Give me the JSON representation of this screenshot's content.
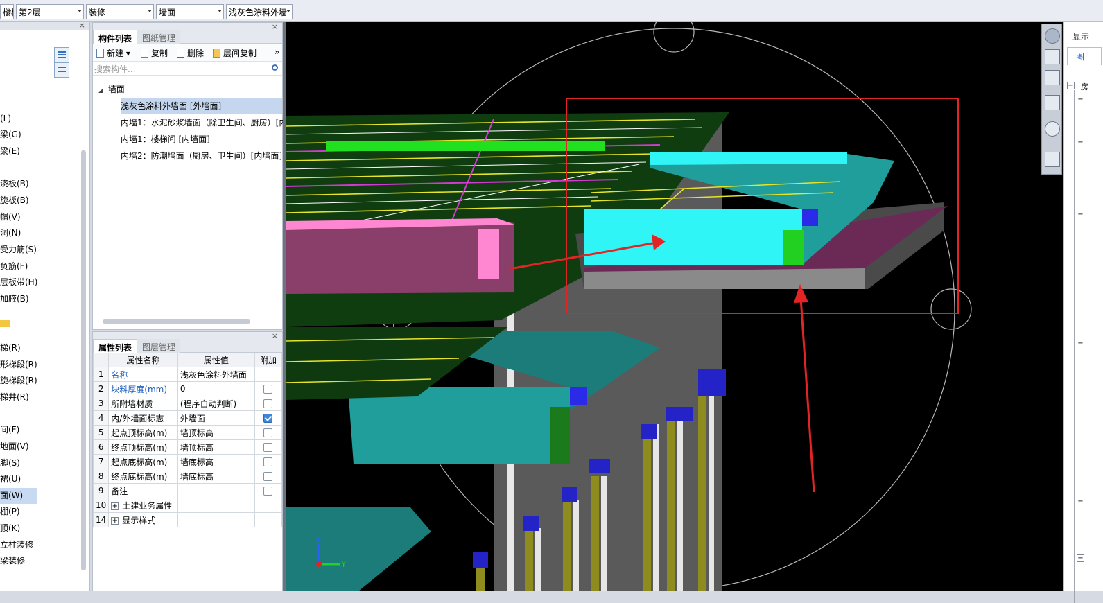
{
  "toolbar": {
    "combo0": "楼梯",
    "combo1": "第2层",
    "combo2": "装修",
    "combo3": "墙面",
    "combo4": "浅灰色涂料外墙"
  },
  "left_nav": [
    "(L)",
    "梁(G)",
    "梁(E)",
    "浇板(B)",
    "旋板(B)",
    "帽(V)",
    "洞(N)",
    "受力筋(S)",
    "负筋(F)",
    "层板带(H)",
    "加腋(B)",
    "梯(R)",
    "形梯段(R)",
    "旋梯段(R)",
    "梯井(R)",
    "间(F)",
    "地面(V)",
    "脚(S)",
    "裙(U)",
    "面(W)",
    "棚(P)",
    "顶(K)",
    "立柱装修",
    "梁装修"
  ],
  "comp_panel": {
    "tab_active": "构件列表",
    "tab_inactive": "图纸管理",
    "btn_new": "新建",
    "btn_copy": "复制",
    "btn_delete": "删除",
    "btn_floor_copy": "层间复制",
    "search_placeholder": "搜索构件...",
    "tree_root": "墙面",
    "items": [
      "浅灰色涂料外墙面 [外墙面]",
      "内墙1：水泥砂浆墙面（除卫生间、厨房）[内",
      "内墙1：楼梯间 [内墙面]",
      "内墙2：防潮墙面（厨房、卫生间）[内墙面]"
    ]
  },
  "props_panel": {
    "tab_active": "属性列表",
    "tab_inactive": "图层管理",
    "col_name": "属性名称",
    "col_value": "属性值",
    "col_extra": "附加",
    "rows": [
      {
        "n": "1",
        "name": "名称",
        "value": "浅灰色涂料外墙面",
        "cb": "none",
        "blue": true
      },
      {
        "n": "2",
        "name": "块料厚度(mm)",
        "value": "0",
        "cb": "off",
        "blue": true
      },
      {
        "n": "3",
        "name": "所附墙材质",
        "value": "(程序自动判断)",
        "cb": "off",
        "blue": false
      },
      {
        "n": "4",
        "name": "内/外墙面标志",
        "value": "外墙面",
        "cb": "on",
        "blue": false
      },
      {
        "n": "5",
        "name": "起点顶标高(m)",
        "value": "墙顶标高",
        "cb": "off",
        "blue": false
      },
      {
        "n": "6",
        "name": "终点顶标高(m)",
        "value": "墙顶标高",
        "cb": "off",
        "blue": false
      },
      {
        "n": "7",
        "name": "起点底标高(m)",
        "value": "墙底标高",
        "cb": "off",
        "blue": false
      },
      {
        "n": "8",
        "name": "终点底标高(m)",
        "value": "墙底标高",
        "cb": "off",
        "blue": false
      },
      {
        "n": "9",
        "name": "备注",
        "value": "",
        "cb": "off",
        "blue": false
      },
      {
        "n": "10",
        "name": "土建业务属性",
        "value": "",
        "cb": "none",
        "blue": false,
        "group": true
      },
      {
        "n": "14",
        "name": "显示样式",
        "value": "",
        "cb": "none",
        "blue": false,
        "group": true
      }
    ]
  },
  "viewport": {
    "axis_y": "Y",
    "axis_z": "Z"
  },
  "right_panel": {
    "header": "显示",
    "tab": "图",
    "item": "房"
  },
  "colors": {
    "highlight_box": "#e22424",
    "arrow": "#e22424",
    "cyan": "#2ff5f7",
    "teal": "#1f9e9c",
    "pink": "#ff86d0",
    "mauve": "#8a3f6a",
    "green": "#00c400"
  }
}
